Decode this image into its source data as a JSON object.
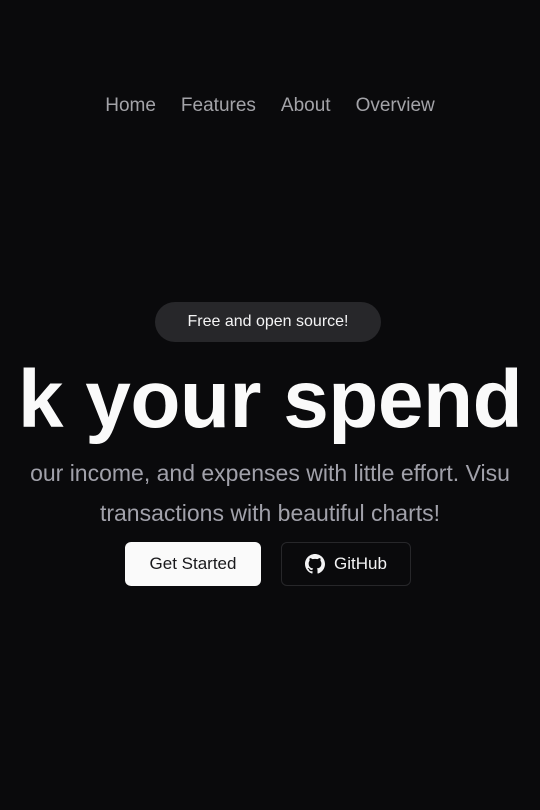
{
  "nav": {
    "items": [
      {
        "label": "Home"
      },
      {
        "label": "Features"
      },
      {
        "label": "About"
      },
      {
        "label": "Overview"
      }
    ]
  },
  "hero": {
    "badge": "Free and open source!",
    "headline": "k your spend",
    "subtext_line1": "our income, and expenses with little effort. Visu",
    "subtext_line2": "transactions with beautiful charts!",
    "primary_button": "Get Started",
    "secondary_button": "GitHub",
    "secondary_icon": "github-icon"
  },
  "colors": {
    "background": "#0a0a0c",
    "primary_button_bg": "#fafafa",
    "badge_bg": "#27272a",
    "muted_text": "#a1a1aa"
  }
}
